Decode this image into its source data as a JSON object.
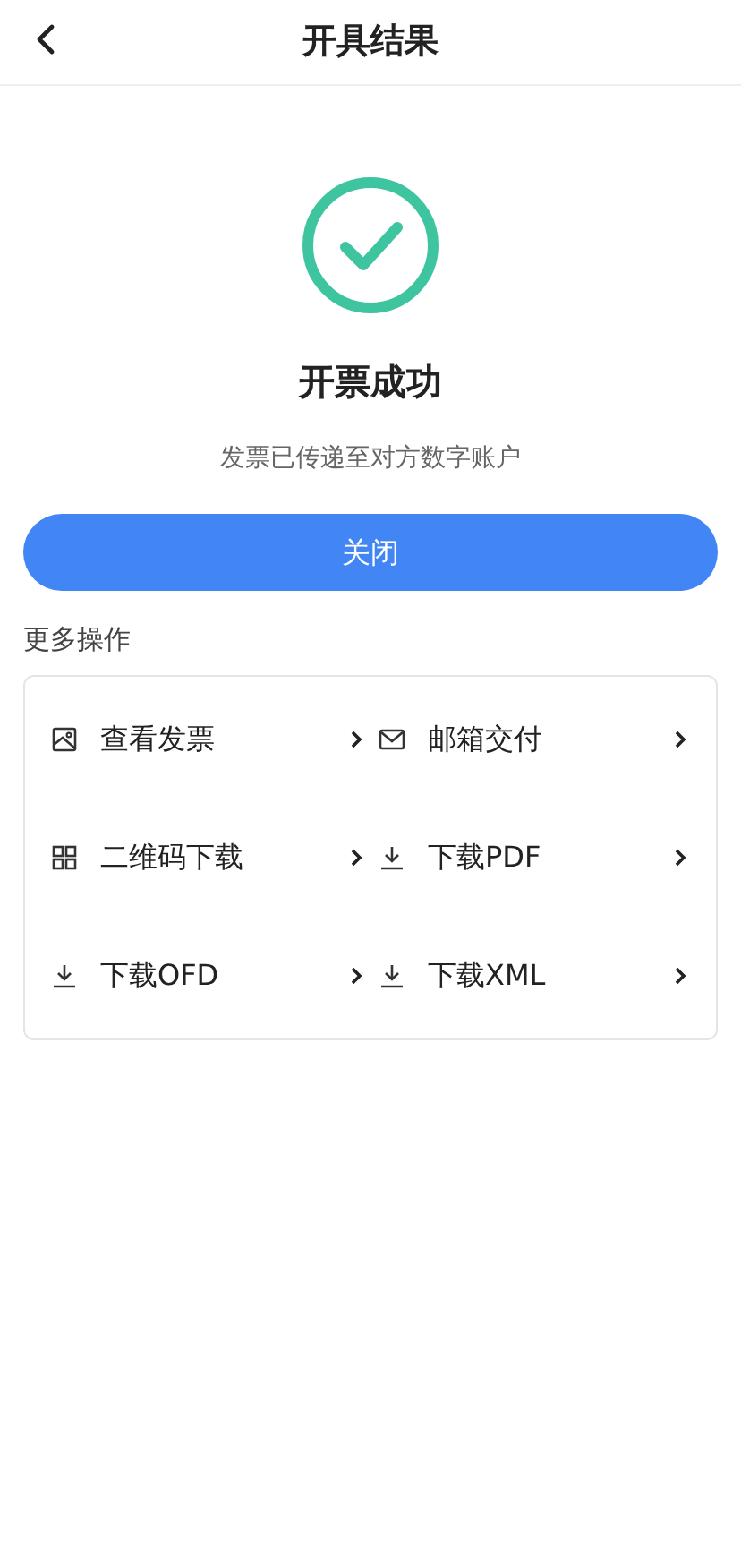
{
  "header": {
    "title": "开具结果"
  },
  "result": {
    "title": "开票成功",
    "message": "发票已传递至对方数字账户"
  },
  "close_button": "关闭",
  "more_section": {
    "title": "更多操作",
    "actions": [
      {
        "kind": "image",
        "label": "查看发票"
      },
      {
        "kind": "mail",
        "label": "邮箱交付"
      },
      {
        "kind": "qrcode",
        "label": "二维码下载"
      },
      {
        "kind": "download",
        "label": "下载PDF"
      },
      {
        "kind": "download",
        "label": "下载OFD"
      },
      {
        "kind": "download",
        "label": "下载XML"
      }
    ]
  }
}
